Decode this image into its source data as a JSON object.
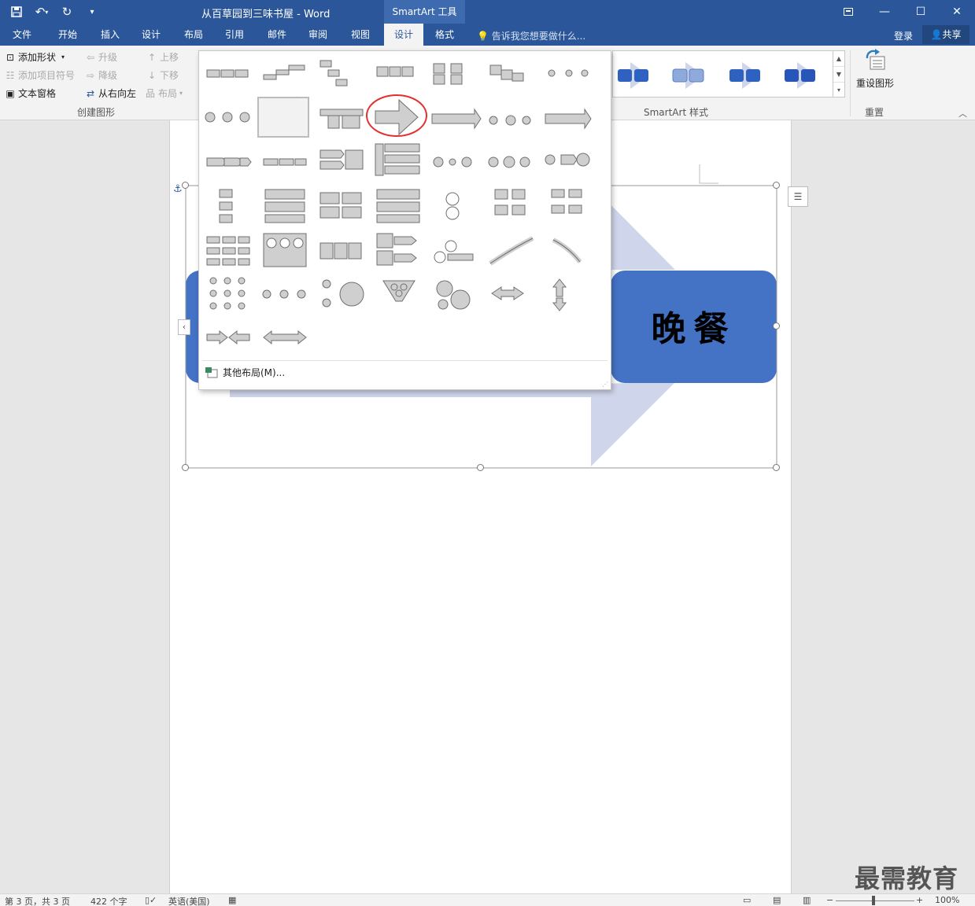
{
  "window": {
    "title": "从百草园到三味书屋 - Word",
    "context_tab_group": "SmartArt 工具",
    "quick_access": [
      "save-icon",
      "undo-icon",
      "redo-icon",
      "customize-icon"
    ]
  },
  "tabs": [
    {
      "label": "文件"
    },
    {
      "label": "开始"
    },
    {
      "label": "插入"
    },
    {
      "label": "设计"
    },
    {
      "label": "布局"
    },
    {
      "label": "引用"
    },
    {
      "label": "邮件"
    },
    {
      "label": "审阅"
    },
    {
      "label": "视图"
    },
    {
      "label": "设计"
    },
    {
      "label": "格式"
    }
  ],
  "tell_me": "告诉我您想要做什么...",
  "account": {
    "login": "登录",
    "share": "共享"
  },
  "ribbon": {
    "create_group": {
      "label": "创建图形",
      "add_shape": "添加形状",
      "add_bullet": "添加项目符号",
      "text_pane": "文本窗格",
      "promote": "升级",
      "demote": "降级",
      "right_to_left": "从右向左",
      "move_up": "上移",
      "move_down": "下移",
      "layout": "布局"
    },
    "styles_group": {
      "label": "SmartArt 样式"
    },
    "reset_group": {
      "label": "重置",
      "reset_graphic": "重设图形"
    }
  },
  "gallery": {
    "more_layouts": "其他布局(M)...",
    "selected_index": 9,
    "highlighted_index": 10
  },
  "document": {
    "smartart_text": "晚餐"
  },
  "status": {
    "page": "第 3 页，共 3 页",
    "words": "422 个字",
    "language": "英语(美国)",
    "zoom": "100%"
  },
  "watermark": "最需教育",
  "colors": {
    "title_bar": "#2b579a",
    "smartart_shape": "#4472c4",
    "smartart_arrow": "#cfd5ea",
    "highlight_ring": "#e0312f"
  }
}
